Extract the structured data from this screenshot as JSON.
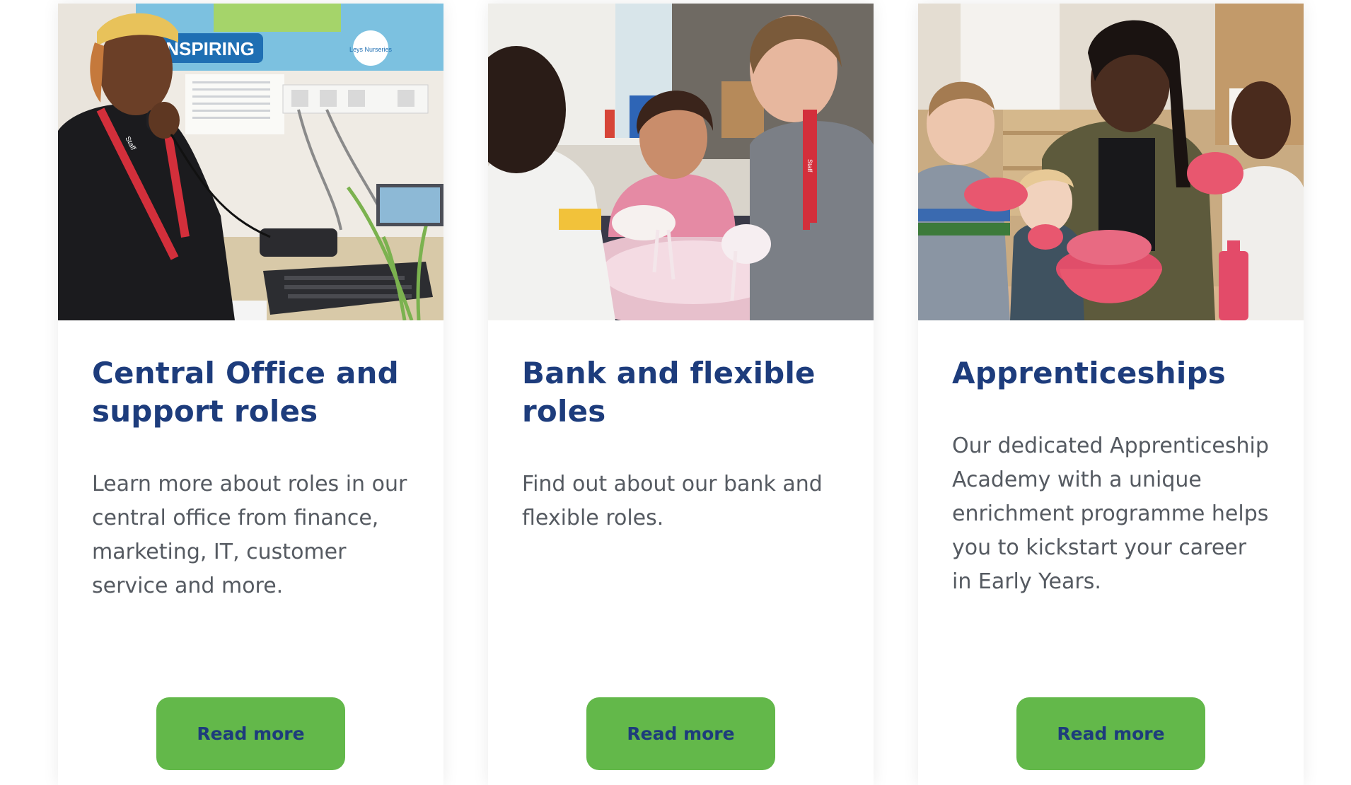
{
  "cards": [
    {
      "title": "Central Office and support roles",
      "body": "Learn more about roles in our central office from finance, marketing, IT, customer service and more.",
      "button_label": "Read more",
      "photo": {
        "poster_text": "INSPIRING",
        "badge_text": "Leys Nurseries",
        "lanyard_text": "Staff"
      }
    },
    {
      "title": "Bank and flexible roles",
      "body": "Find out about our bank and flexible roles.",
      "button_label": "Read more",
      "photo": {
        "lanyard_text": "Staff"
      }
    },
    {
      "title": "Apprenticeships",
      "body": "Our dedicated Apprenticeship Academy with a unique enrichment programme helps you to kickstart your career in Early Years.",
      "button_label": "Read more",
      "photo": {}
    }
  ],
  "colors": {
    "title": "#1d3c7c",
    "body": "#555a61",
    "button_bg": "#63b84a",
    "button_text": "#1d3c7c"
  }
}
